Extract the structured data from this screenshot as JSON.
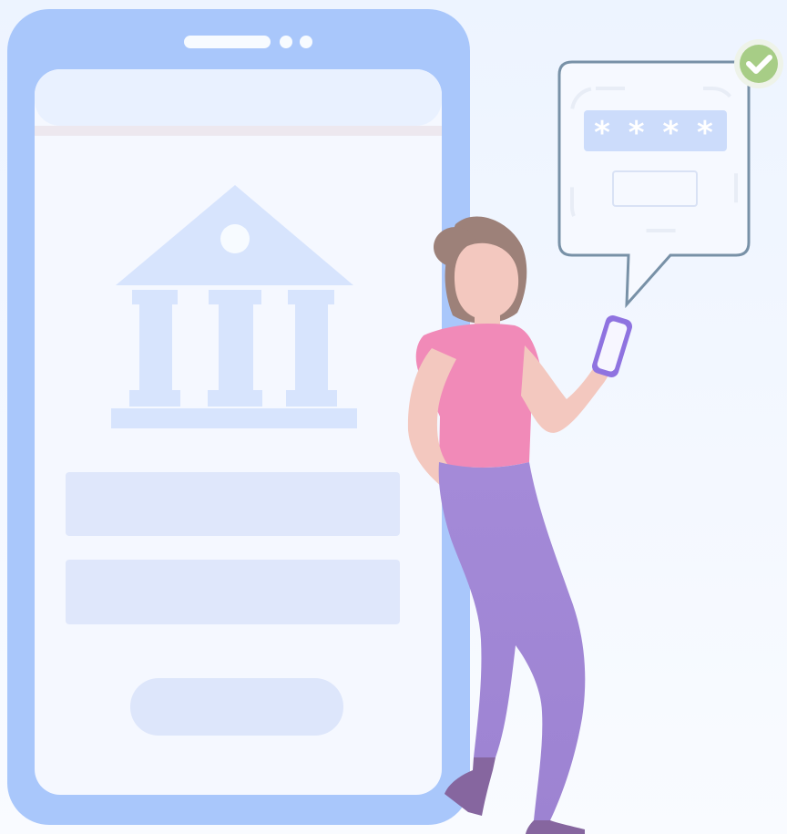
{
  "illustration": {
    "password_mask": "* * * *",
    "icons": {
      "bank": "bank-building-icon",
      "check": "checkmark-icon",
      "speech": "speech-bubble-icon"
    },
    "colors": {
      "background_top": "#edf4ff",
      "background_bottom": "#f7f9ff",
      "phone_frame": "#a9c7fb",
      "phone_screen": "#f5f8ff",
      "bank": "#d7e4fd",
      "field": "#dfe7fb",
      "button": "#dde6fb",
      "shirt": "#f18ab8",
      "pants": "#a988d7",
      "hair": "#9d8179",
      "skin": "#f3c8bf",
      "check_bg": "#dfe9d7",
      "check_fg": "#9bc56f",
      "bubble_border": "#7891a7"
    }
  }
}
